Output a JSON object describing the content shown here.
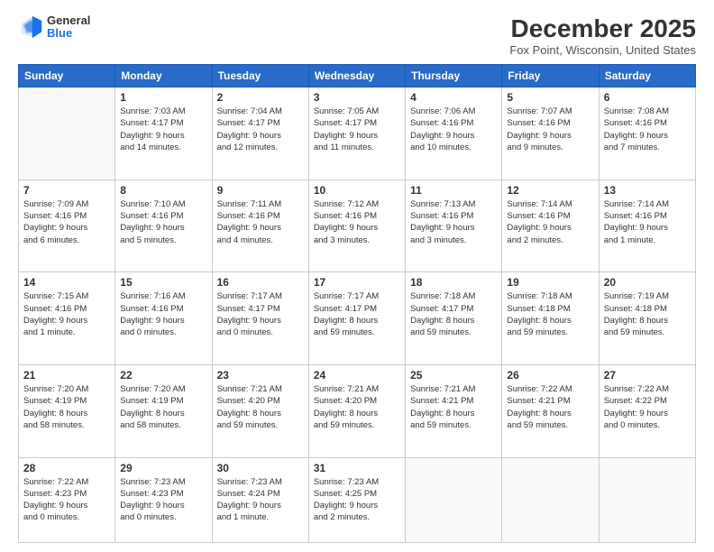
{
  "logo": {
    "general": "General",
    "blue": "Blue"
  },
  "title": "December 2025",
  "location": "Fox Point, Wisconsin, United States",
  "days_of_week": [
    "Sunday",
    "Monday",
    "Tuesday",
    "Wednesday",
    "Thursday",
    "Friday",
    "Saturday"
  ],
  "weeks": [
    [
      {
        "day": "",
        "info": ""
      },
      {
        "day": "1",
        "info": "Sunrise: 7:03 AM\nSunset: 4:17 PM\nDaylight: 9 hours\nand 14 minutes."
      },
      {
        "day": "2",
        "info": "Sunrise: 7:04 AM\nSunset: 4:17 PM\nDaylight: 9 hours\nand 12 minutes."
      },
      {
        "day": "3",
        "info": "Sunrise: 7:05 AM\nSunset: 4:17 PM\nDaylight: 9 hours\nand 11 minutes."
      },
      {
        "day": "4",
        "info": "Sunrise: 7:06 AM\nSunset: 4:16 PM\nDaylight: 9 hours\nand 10 minutes."
      },
      {
        "day": "5",
        "info": "Sunrise: 7:07 AM\nSunset: 4:16 PM\nDaylight: 9 hours\nand 9 minutes."
      },
      {
        "day": "6",
        "info": "Sunrise: 7:08 AM\nSunset: 4:16 PM\nDaylight: 9 hours\nand 7 minutes."
      }
    ],
    [
      {
        "day": "7",
        "info": "Sunrise: 7:09 AM\nSunset: 4:16 PM\nDaylight: 9 hours\nand 6 minutes."
      },
      {
        "day": "8",
        "info": "Sunrise: 7:10 AM\nSunset: 4:16 PM\nDaylight: 9 hours\nand 5 minutes."
      },
      {
        "day": "9",
        "info": "Sunrise: 7:11 AM\nSunset: 4:16 PM\nDaylight: 9 hours\nand 4 minutes."
      },
      {
        "day": "10",
        "info": "Sunrise: 7:12 AM\nSunset: 4:16 PM\nDaylight: 9 hours\nand 3 minutes."
      },
      {
        "day": "11",
        "info": "Sunrise: 7:13 AM\nSunset: 4:16 PM\nDaylight: 9 hours\nand 3 minutes."
      },
      {
        "day": "12",
        "info": "Sunrise: 7:14 AM\nSunset: 4:16 PM\nDaylight: 9 hours\nand 2 minutes."
      },
      {
        "day": "13",
        "info": "Sunrise: 7:14 AM\nSunset: 4:16 PM\nDaylight: 9 hours\nand 1 minute."
      }
    ],
    [
      {
        "day": "14",
        "info": "Sunrise: 7:15 AM\nSunset: 4:16 PM\nDaylight: 9 hours\nand 1 minute."
      },
      {
        "day": "15",
        "info": "Sunrise: 7:16 AM\nSunset: 4:16 PM\nDaylight: 9 hours\nand 0 minutes."
      },
      {
        "day": "16",
        "info": "Sunrise: 7:17 AM\nSunset: 4:17 PM\nDaylight: 9 hours\nand 0 minutes."
      },
      {
        "day": "17",
        "info": "Sunrise: 7:17 AM\nSunset: 4:17 PM\nDaylight: 8 hours\nand 59 minutes."
      },
      {
        "day": "18",
        "info": "Sunrise: 7:18 AM\nSunset: 4:17 PM\nDaylight: 8 hours\nand 59 minutes."
      },
      {
        "day": "19",
        "info": "Sunrise: 7:18 AM\nSunset: 4:18 PM\nDaylight: 8 hours\nand 59 minutes."
      },
      {
        "day": "20",
        "info": "Sunrise: 7:19 AM\nSunset: 4:18 PM\nDaylight: 8 hours\nand 59 minutes."
      }
    ],
    [
      {
        "day": "21",
        "info": "Sunrise: 7:20 AM\nSunset: 4:19 PM\nDaylight: 8 hours\nand 58 minutes."
      },
      {
        "day": "22",
        "info": "Sunrise: 7:20 AM\nSunset: 4:19 PM\nDaylight: 8 hours\nand 58 minutes."
      },
      {
        "day": "23",
        "info": "Sunrise: 7:21 AM\nSunset: 4:20 PM\nDaylight: 8 hours\nand 59 minutes."
      },
      {
        "day": "24",
        "info": "Sunrise: 7:21 AM\nSunset: 4:20 PM\nDaylight: 8 hours\nand 59 minutes."
      },
      {
        "day": "25",
        "info": "Sunrise: 7:21 AM\nSunset: 4:21 PM\nDaylight: 8 hours\nand 59 minutes."
      },
      {
        "day": "26",
        "info": "Sunrise: 7:22 AM\nSunset: 4:21 PM\nDaylight: 8 hours\nand 59 minutes."
      },
      {
        "day": "27",
        "info": "Sunrise: 7:22 AM\nSunset: 4:22 PM\nDaylight: 9 hours\nand 0 minutes."
      }
    ],
    [
      {
        "day": "28",
        "info": "Sunrise: 7:22 AM\nSunset: 4:23 PM\nDaylight: 9 hours\nand 0 minutes."
      },
      {
        "day": "29",
        "info": "Sunrise: 7:23 AM\nSunset: 4:23 PM\nDaylight: 9 hours\nand 0 minutes."
      },
      {
        "day": "30",
        "info": "Sunrise: 7:23 AM\nSunset: 4:24 PM\nDaylight: 9 hours\nand 1 minute."
      },
      {
        "day": "31",
        "info": "Sunrise: 7:23 AM\nSunset: 4:25 PM\nDaylight: 9 hours\nand 2 minutes."
      },
      {
        "day": "",
        "info": ""
      },
      {
        "day": "",
        "info": ""
      },
      {
        "day": "",
        "info": ""
      }
    ]
  ]
}
